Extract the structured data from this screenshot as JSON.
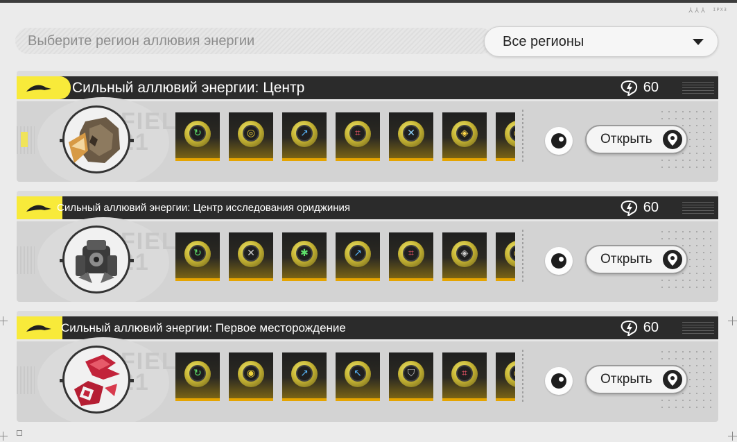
{
  "region_selector": {
    "prompt": "Выберите регион аллювия энергии",
    "selected": "Все регионы"
  },
  "corner_mark": "IPX3",
  "cards": [
    {
      "title": "Сильный аллювий энергии: Центр",
      "energy": "60",
      "open_label": "Открыть",
      "items": [
        "swirl-glyph",
        "eye-glyph",
        "arrow-glyph",
        "grid-glyph",
        "cross-glyph",
        "diamond-glyph",
        "ring-glyph"
      ]
    },
    {
      "title": "Сильный аллювий энергии: Центр исследования ориджиния",
      "energy": "60",
      "open_label": "Открыть",
      "items": [
        "swirl-glyph",
        "cross-glyph",
        "star-glyph",
        "arrow-glyph",
        "grid-glyph",
        "diamond-glyph",
        "ring-glyph"
      ]
    },
    {
      "title": "Сильный аллювий энергии: Первое месторождение",
      "energy": "60",
      "open_label": "Открыть",
      "items": [
        "swirl-glyph",
        "eye-glyph",
        "arrow-glyph",
        "arrow-glyph",
        "shield-glyph",
        "grid-glyph",
        "ring-glyph"
      ]
    }
  ],
  "colors": {
    "accent_yellow": "#f8ea3a",
    "header_dark": "#2b2b2b",
    "item_border": "#e5a400"
  }
}
